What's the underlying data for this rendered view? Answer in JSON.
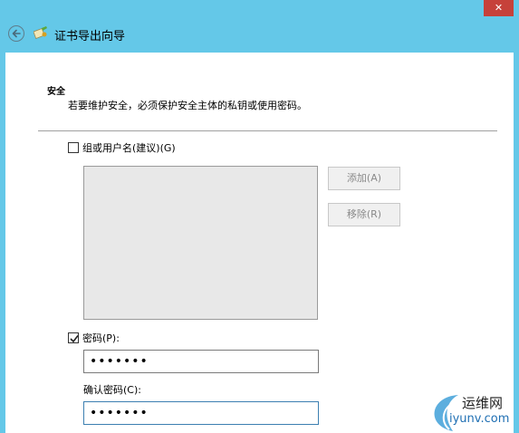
{
  "window": {
    "close_glyph": "✕",
    "title": "证书导出向导",
    "accent": "#64c8e8"
  },
  "section": {
    "title": "安全",
    "description": "若要维护安全，必须保护安全主体的私钥或使用密码。"
  },
  "group_option": {
    "label": "组或用户名(建议)(G)",
    "checked": false
  },
  "buttons": {
    "add": "添加(A)",
    "remove": "移除(R)"
  },
  "password_option": {
    "label": "密码(P):",
    "checked": true,
    "value": "•••••••"
  },
  "confirm": {
    "label": "确认密码(C):",
    "value": "•••••••"
  },
  "watermark": {
    "line1": "运维网",
    "line2": "iyunv.com"
  },
  "icons": {
    "back": "back-arrow-icon",
    "wizard": "certificate-wizard-icon",
    "check": "checkmark-icon"
  }
}
